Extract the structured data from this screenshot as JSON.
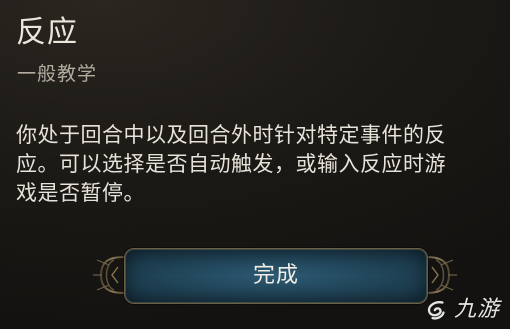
{
  "dialog": {
    "title": "反应",
    "subtitle": "一般教学",
    "body_lines": [
      "你处于回合中以及回合外时针对特定事件的反",
      "应。可以选择是否自动触发，或输入反应时游",
      "戏是否暂停。"
    ],
    "done_button_label": "完成"
  },
  "watermark": {
    "text": "九游",
    "icon": "swirl-logo-icon"
  },
  "colors": {
    "background": "#1b1915",
    "title": "#ece7dd",
    "subtitle": "#b3aca0",
    "body": "#e8e3da",
    "button_fill": "#1f4154",
    "button_border": "#6a5e43",
    "ornament": "#7b6b4a"
  }
}
